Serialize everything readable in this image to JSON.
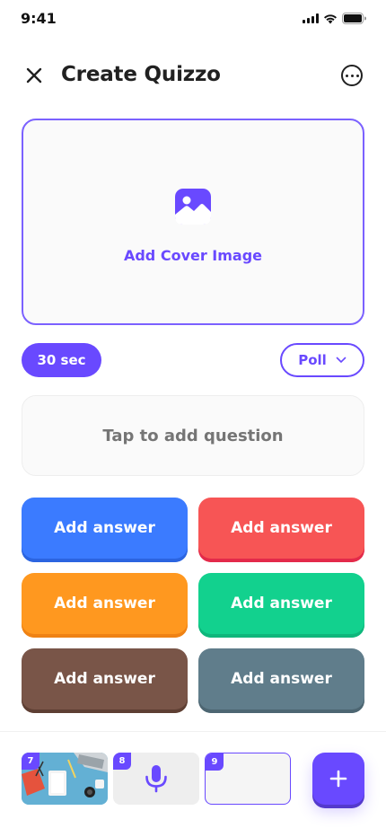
{
  "status_bar": {
    "time": "9:41"
  },
  "header": {
    "title": "Create Quizzo"
  },
  "cover": {
    "label": "Add Cover Image"
  },
  "controls": {
    "time_limit": "30 sec",
    "question_type": "Poll"
  },
  "question": {
    "placeholder": "Tap to add question"
  },
  "answers": [
    {
      "label": "Add answer",
      "color": "#3b7bff",
      "shade": "#2b64e0"
    },
    {
      "label": "Add answer",
      "color": "#f75555",
      "shade": "#e32a4a"
    },
    {
      "label": "Add answer",
      "color": "#ff981f",
      "shade": "#ef8214"
    },
    {
      "label": "Add answer",
      "color": "#12d18e",
      "shade": "#0fb67b"
    },
    {
      "label": "Add answer",
      "color": "#795548",
      "shade": "#5e3f33"
    },
    {
      "label": "Add answer",
      "color": "#607d8b",
      "shade": "#4d6672"
    }
  ],
  "slides": [
    {
      "number": "7",
      "icon": "image-thumbnail"
    },
    {
      "number": "8",
      "icon": "microphone-icon"
    },
    {
      "number": "9",
      "icon": "empty-slide",
      "selected": true
    }
  ],
  "colors": {
    "accent": "#6949ff",
    "text": "#212121",
    "muted": "#757575"
  }
}
